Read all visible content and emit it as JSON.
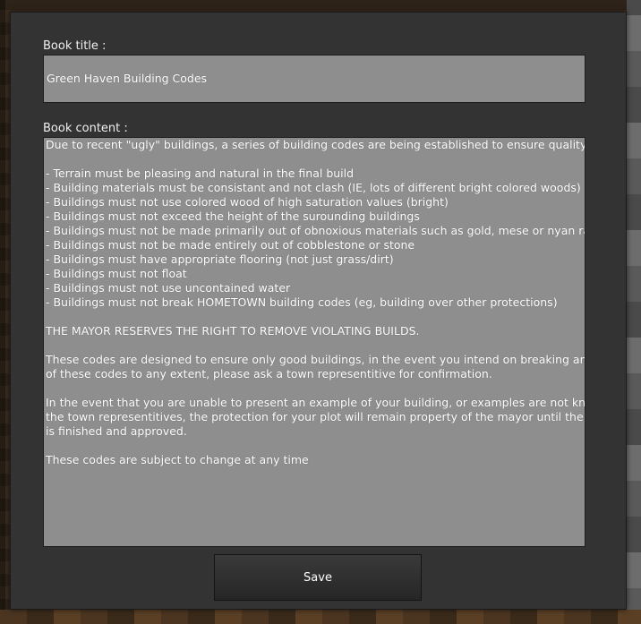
{
  "dialog": {
    "title_label": "Book title :",
    "title_value": "Green Haven Building Codes",
    "content_label": "Book content :",
    "content_lines": [
      "Due to recent \"ugly\" buildings, a series of building codes are being established to ensure quality builds:",
      "",
      "- Terrain must be pleasing and natural in the final build",
      "- Building materials must be consistant and not clash (IE, lots of different bright colored woods)",
      "- Buildings must not use colored wood of high saturation values (bright)",
      "- Buildings must not exceed the height of the surounding buildings",
      "- Buildings must not be made primarily out of obnoxious materials such as gold, mese or nyan rainbows",
      "- Buildings must not be made entirely out of cobblestone or stone",
      "- Buildings must have appropriate flooring (not just grass/dirt)",
      "- Buildings must not float",
      "- Buildings must not use uncontained water",
      "- Buildings must not break HOMETOWN building codes (eg, building over other protections)",
      "",
      "THE MAYOR RESERVES THE RIGHT TO REMOVE VIOLATING BUILDS.",
      "",
      "These codes are designed to ensure only good buildings, in the event you intend on breaking any one",
      "of these codes to any extent, please ask a town representitive for confirmation.",
      "",
      "In the event that you are unable to present an example of your building, or examples are not known to",
      "the town representitives, the protection for your plot will remain property of the mayor until the building",
      "is finished and approved.",
      "",
      "These codes are subject to change at any time"
    ],
    "save_label": "Save"
  }
}
